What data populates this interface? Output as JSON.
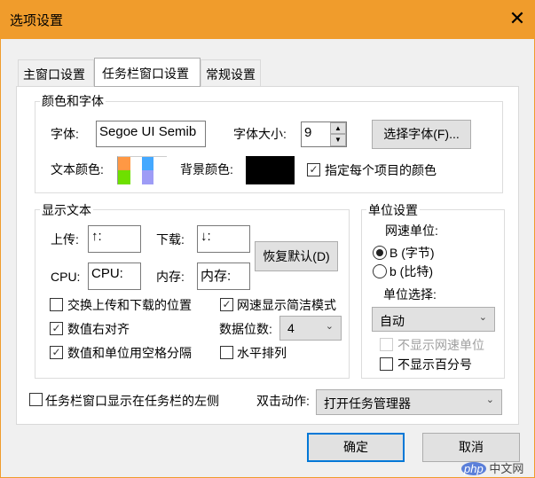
{
  "window": {
    "title": "选项设置",
    "close_icon": "close-icon"
  },
  "tabs": [
    {
      "label": "主窗口设置"
    },
    {
      "label": "任务栏窗口设置",
      "selected": true
    },
    {
      "label": "常规设置"
    }
  ],
  "color_font": {
    "group_label": "颜色和字体",
    "font_label": "字体:",
    "font_value": "Segoe UI Semib",
    "font_size_label": "字体大小:",
    "font_size_value": "9",
    "choose_font_button": "选择字体(F)...",
    "text_color_label": "文本颜色:",
    "text_colors": [
      "#ff9844",
      "#6ee000",
      "#44a8ff",
      "#9e9cf6"
    ],
    "bg_color_label": "背景颜色:",
    "bg_color": "#000000",
    "per_item_color_label": "指定每个项目的颜色",
    "per_item_color_checked": true
  },
  "display_text": {
    "group_label": "显示文本",
    "upload_label": "上传:",
    "upload_value": "↑:",
    "download_label": "下载:",
    "download_value": "↓:",
    "cpu_label": "CPU:",
    "cpu_value": "CPU:",
    "memory_label": "内存:",
    "memory_value": "内存:",
    "restore_default_button": "恢复默认(D)",
    "swap_label": "交换上传和下载的位置",
    "swap_checked": false,
    "simple_mode_label": "网速显示简洁模式",
    "simple_mode_checked": true,
    "right_align_label": "数值右对齐",
    "right_align_checked": true,
    "digits_label": "数据位数:",
    "digits_value": "4",
    "space_sep_label": "数值和单位用空格分隔",
    "space_sep_checked": true,
    "horizontal_label": "水平排列",
    "horizontal_checked": false
  },
  "unit": {
    "group_label": "单位设置",
    "speed_unit_label": "网速单位:",
    "radio_byte": "B (字节)",
    "radio_bit": "b (比特)",
    "selected": "byte",
    "unit_select_label": "单位选择:",
    "unit_select_value": "自动",
    "hide_speed_unit_label": "不显示网速单位",
    "hide_percent_label": "不显示百分号"
  },
  "bottom": {
    "left_side_label": "任务栏窗口显示在任务栏的左侧",
    "left_side_checked": false,
    "dblclick_label": "双击动作:",
    "dblclick_value": "打开任务管理器"
  },
  "buttons": {
    "ok": "确定",
    "cancel": "取消"
  },
  "watermark": "php中文网"
}
